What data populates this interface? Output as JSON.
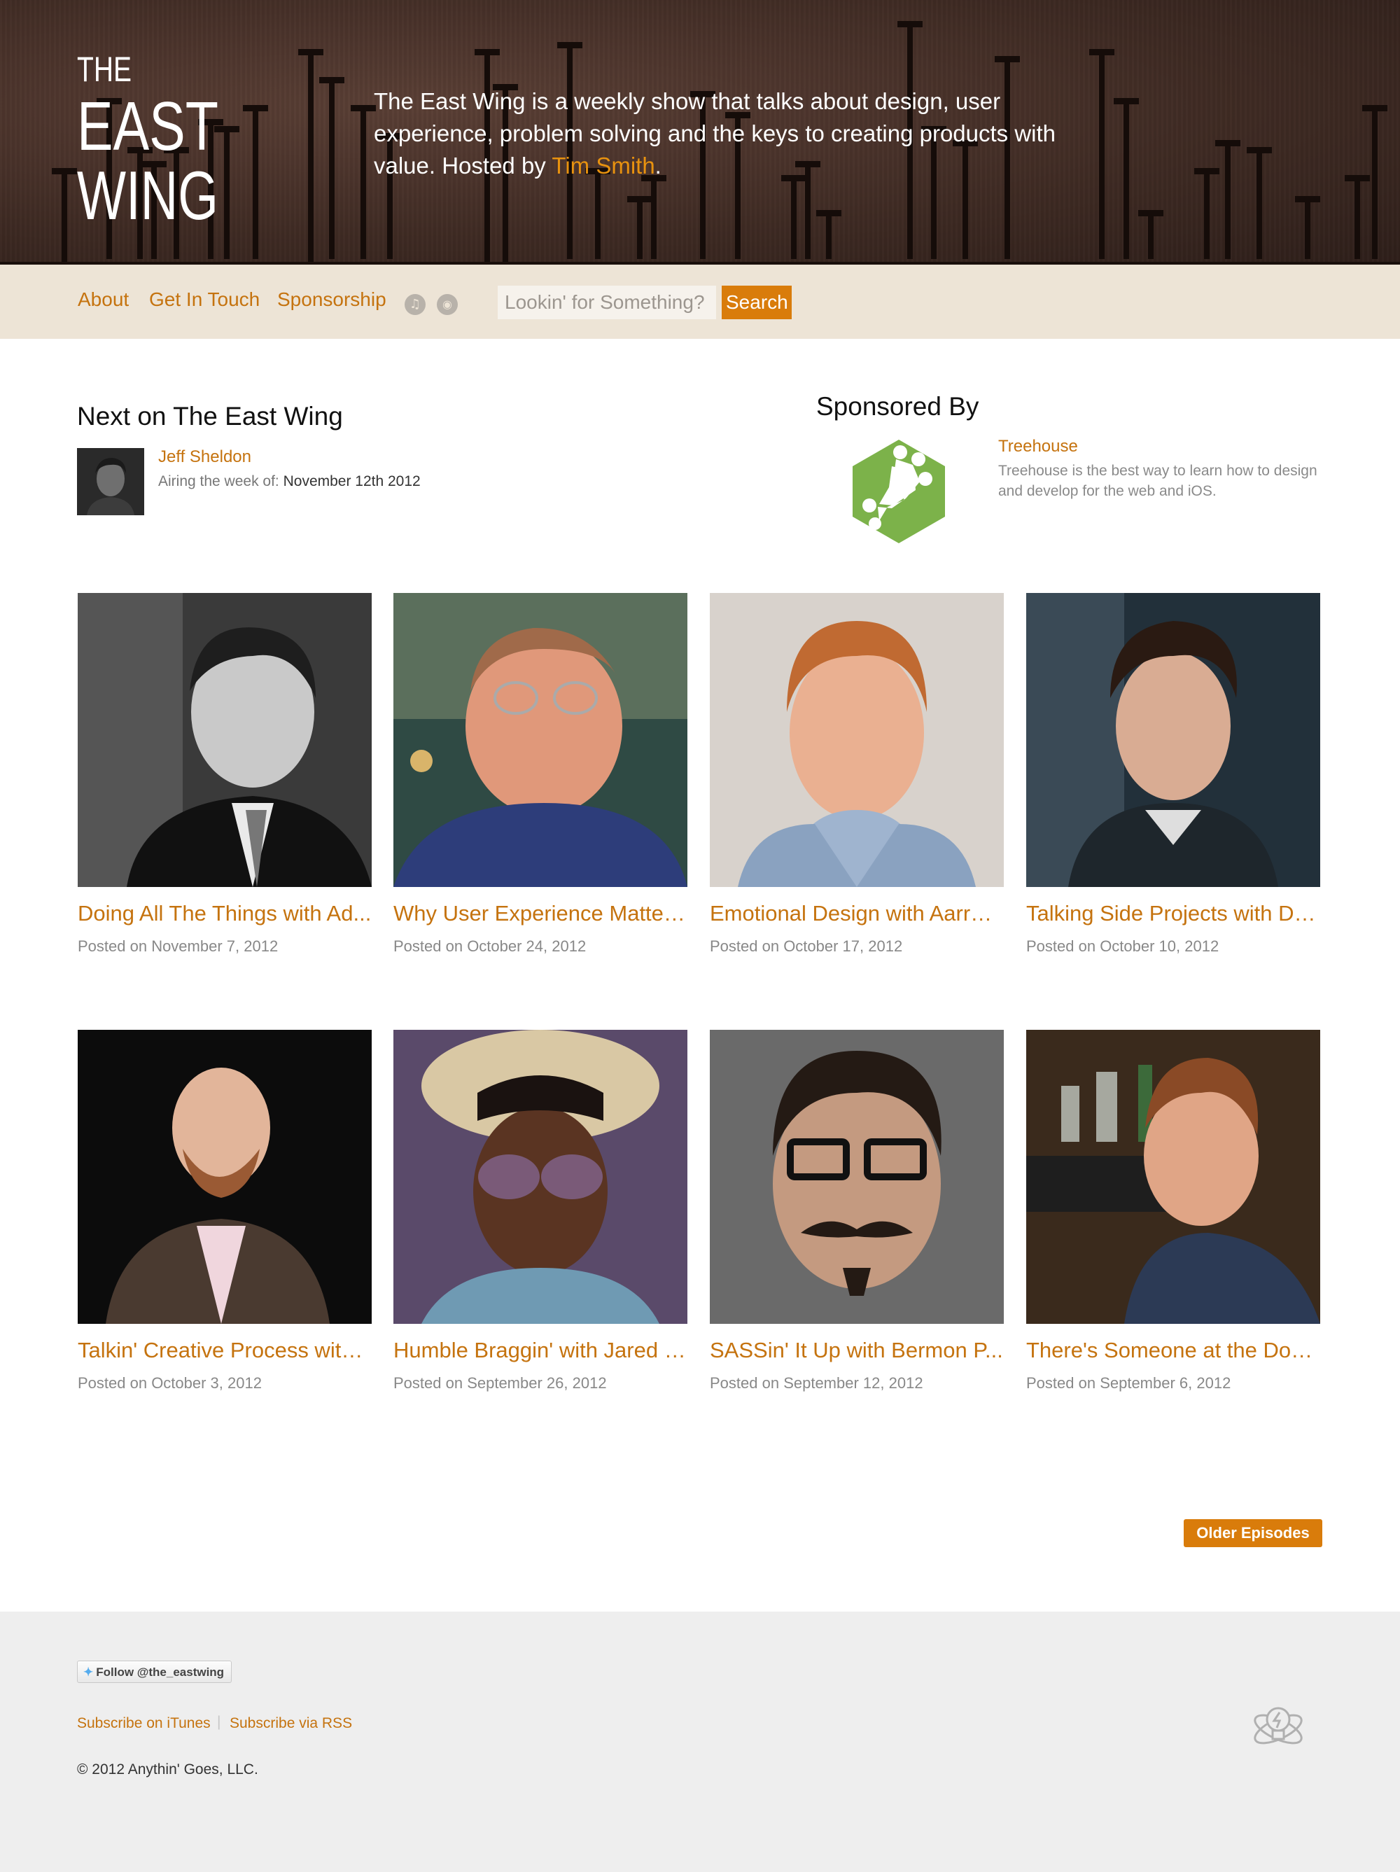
{
  "header": {
    "logo_lines": [
      "THE",
      "EAST",
      "WING"
    ],
    "tagline": "The East Wing is a weekly show that talks about design, user experience, problem solving and the keys to creating products with value. Hosted by ",
    "host_name": "Tim Smith",
    "tagline_end": "."
  },
  "nav": {
    "links": [
      "About",
      "Get In Touch",
      "Sponsorship"
    ],
    "icons": [
      "itunes-icon",
      "rss-icon"
    ],
    "search_placeholder": "Lookin' for Something?",
    "search_button": "Search"
  },
  "next": {
    "title": "Next on The East Wing",
    "guest": "Jeff Sheldon",
    "airing_label": "Airing the week of: ",
    "airing_date": "November 12th 2012"
  },
  "sponsor": {
    "title": "Sponsored By",
    "name": "Treehouse",
    "description": "Treehouse is the best way to learn how to design and develop for the web and iOS.",
    "brand_color": "#7cb24a"
  },
  "episodes": [
    {
      "title": "Doing All The Things with Ad...",
      "date": "Posted on November 7, 2012"
    },
    {
      "title": "Why User Experience Matters...",
      "date": "Posted on October 24, 2012"
    },
    {
      "title": "Emotional Design with Aarron...",
      "date": "Posted on October 17, 2012"
    },
    {
      "title": "Talking Side Projects with Da...",
      "date": "Posted on October 10, 2012"
    },
    {
      "title": "Talkin' Creative Process with ...",
      "date": "Posted on October 3, 2012"
    },
    {
      "title": "Humble Braggin' with Jared E...",
      "date": "Posted on September 26, 2012"
    },
    {
      "title": "SASSin' It Up with Bermon P...",
      "date": "Posted on September 12, 2012"
    },
    {
      "title": "There's Someone at the Door...",
      "date": "Posted on September 6, 2012"
    }
  ],
  "older_button": "Older Episodes",
  "footer": {
    "follow_label": "Follow @the_eastwing",
    "subscribe_itunes": "Subscribe on iTunes",
    "separator": "|",
    "subscribe_rss": "Subscribe via RSS",
    "copyright": "© 2012 Anythin' Goes, LLC."
  },
  "colors": {
    "accent": "#c5730f",
    "button": "#d97c0b",
    "header_bg": "#3e2a23",
    "nav_bg": "#ede4d6",
    "footer_bg": "#eeeeee"
  }
}
